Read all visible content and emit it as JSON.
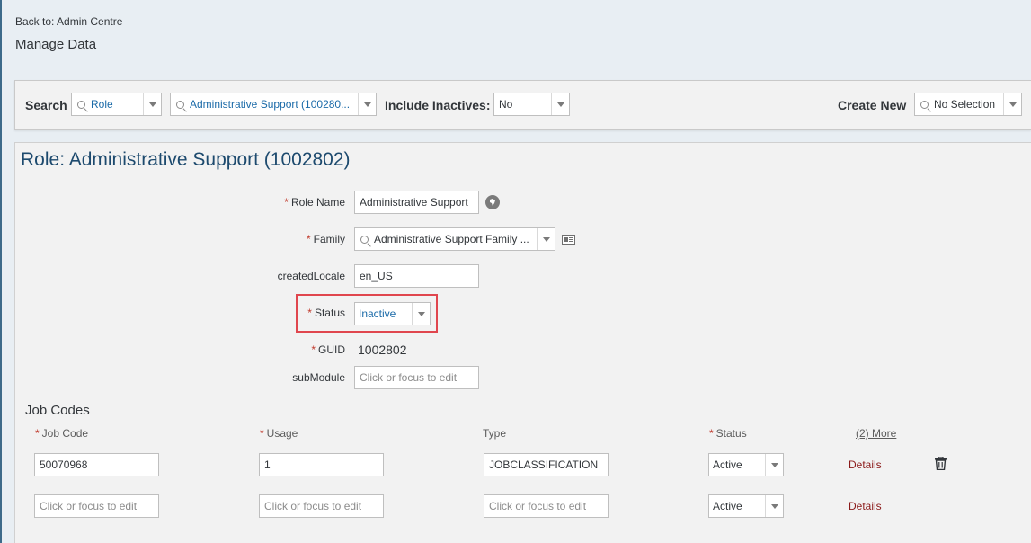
{
  "nav": {
    "back_link": "Back to: Admin Centre",
    "page_title": "Manage Data"
  },
  "search_bar": {
    "search_label": "Search",
    "object_type": "Role",
    "object_value": "Administrative Support (100280...",
    "include_inactives_label": "Include Inactives:",
    "include_inactives_value": "No",
    "create_new_label": "Create New",
    "create_new_value": "No Selection"
  },
  "record": {
    "title": "Role: Administrative Support (1002802)",
    "fields": {
      "role_name": {
        "label": "Role Name",
        "value": "Administrative Support",
        "required": true
      },
      "family": {
        "label": "Family",
        "value": "Administrative Support Family ...",
        "required": true
      },
      "created_locale": {
        "label": "createdLocale",
        "value": "en_US",
        "required": false
      },
      "status": {
        "label": "Status",
        "value": "Inactive",
        "required": true
      },
      "guid": {
        "label": "GUID",
        "value": "1002802",
        "required": true
      },
      "sub_module": {
        "label": "subModule",
        "placeholder": "Click or focus to edit",
        "required": false
      }
    },
    "required_marker": "*"
  },
  "job_codes": {
    "title": "Job Codes",
    "columns": {
      "job_code": "Job Code",
      "usage": "Usage",
      "type": "Type",
      "status": "Status",
      "more": "(2) More"
    },
    "rows": [
      {
        "job_code": "50070968",
        "usage": "1",
        "type": "JOBCLASSIFICATION",
        "status": "Active",
        "details": "Details"
      },
      {
        "job_code_placeholder": "Click or focus to edit",
        "usage_placeholder": "Click or focus to edit",
        "type_placeholder": "Click or focus to edit",
        "status": "Active",
        "details": "Details"
      }
    ]
  },
  "colors": {
    "title_blue": "#1d4a6e",
    "link_blue": "#1a6aa8",
    "required_red": "#c0392b",
    "highlight_red": "#e0464e",
    "details_link": "#8b1a1a"
  },
  "icons": [
    "search-icon",
    "dropdown-caret-icon",
    "globe-icon",
    "value-help-card-icon",
    "trash-icon"
  ]
}
